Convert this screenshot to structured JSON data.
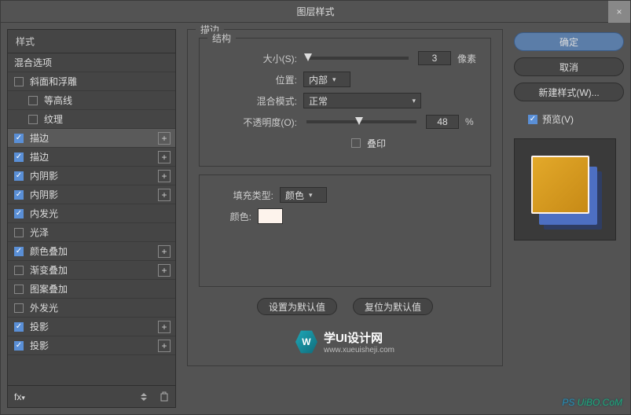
{
  "window": {
    "title": "图层样式",
    "close": "×"
  },
  "left": {
    "header": "样式",
    "blendOptions": "混合选项",
    "items": [
      {
        "label": "斜面和浮雕",
        "checked": false,
        "indent": 0,
        "plus": false
      },
      {
        "label": "等高线",
        "checked": false,
        "indent": 1,
        "plus": false
      },
      {
        "label": "纹理",
        "checked": false,
        "indent": 1,
        "plus": false
      },
      {
        "label": "描边",
        "checked": true,
        "indent": 0,
        "plus": true,
        "selected": true
      },
      {
        "label": "描边",
        "checked": true,
        "indent": 0,
        "plus": true
      },
      {
        "label": "内阴影",
        "checked": true,
        "indent": 0,
        "plus": true
      },
      {
        "label": "内阴影",
        "checked": true,
        "indent": 0,
        "plus": true
      },
      {
        "label": "内发光",
        "checked": true,
        "indent": 0,
        "plus": false
      },
      {
        "label": "光泽",
        "checked": false,
        "indent": 0,
        "plus": false
      },
      {
        "label": "颜色叠加",
        "checked": true,
        "indent": 0,
        "plus": true
      },
      {
        "label": "渐变叠加",
        "checked": false,
        "indent": 0,
        "plus": true
      },
      {
        "label": "图案叠加",
        "checked": false,
        "indent": 0,
        "plus": false
      },
      {
        "label": "外发光",
        "checked": false,
        "indent": 0,
        "plus": false
      },
      {
        "label": "投影",
        "checked": true,
        "indent": 0,
        "plus": true
      },
      {
        "label": "投影",
        "checked": true,
        "indent": 0,
        "plus": true
      }
    ],
    "footer": {
      "fx": "fx"
    }
  },
  "middle": {
    "section": "描边",
    "structure": "结构",
    "size": {
      "label": "大小(S):",
      "value": "3",
      "unit": "像素"
    },
    "position": {
      "label": "位置:",
      "value": "内部"
    },
    "blendMode": {
      "label": "混合模式:",
      "value": "正常"
    },
    "opacity": {
      "label": "不透明度(O):",
      "value": "48",
      "unit": "%"
    },
    "overprint": {
      "label": "叠印"
    },
    "fillType": {
      "label": "填充类型:",
      "value": "颜色"
    },
    "color": {
      "label": "颜色:"
    },
    "setDefault": "设置为默认值",
    "resetDefault": "复位为默认值",
    "watermark": {
      "title": "学UI设计网",
      "url": "www.xueuisheji.com"
    }
  },
  "right": {
    "ok": "确定",
    "cancel": "取消",
    "newStyle": "新建样式(W)...",
    "preview": "预览(V)"
  },
  "footer": {
    "wm": "UiBO.CoM"
  }
}
